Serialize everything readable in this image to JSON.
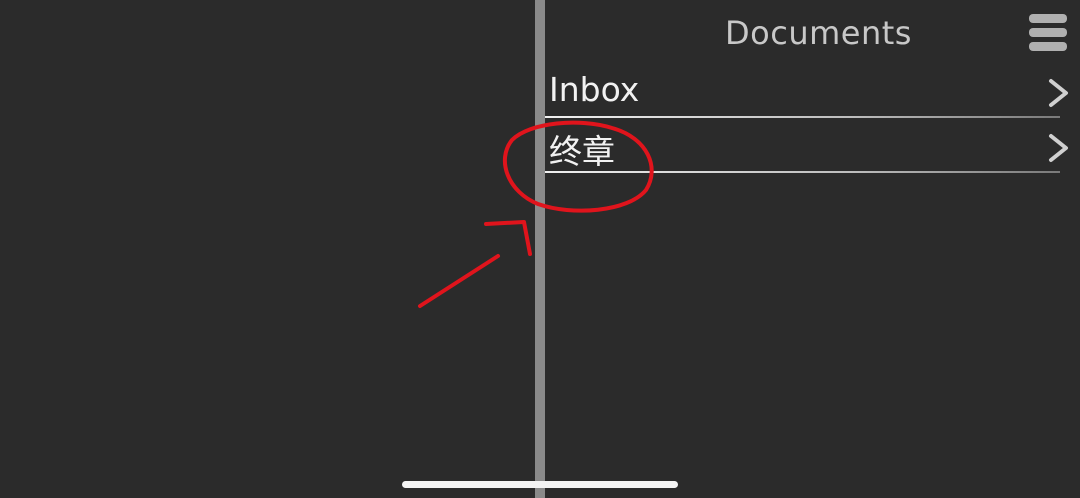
{
  "header": {
    "title": "Documents",
    "menu_icon": "hamburger-menu-icon"
  },
  "list": {
    "items": [
      {
        "label": "Inbox",
        "icon": "chevron-right-icon"
      },
      {
        "label": "终章",
        "icon": "chevron-right-icon"
      }
    ]
  },
  "annotation": {
    "color": "#e0141c",
    "shapes": [
      "circle",
      "arrow"
    ]
  },
  "colors": {
    "background": "#2b2b2b",
    "splitter": "#8a8a8a",
    "title_text": "#c8c8c8",
    "row_text": "#f2f2f2"
  }
}
